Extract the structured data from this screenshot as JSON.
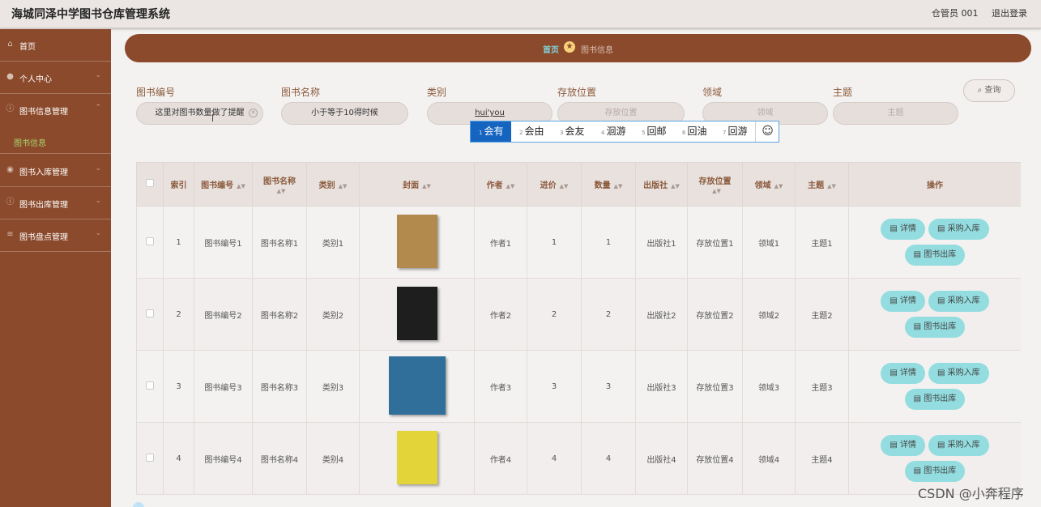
{
  "header": {
    "title": "海城同泽中学图书仓库管理系统",
    "user": "仓管员 001",
    "logout": "退出登录"
  },
  "sidebar": {
    "items": [
      {
        "label": "首页",
        "icon": "home-icon"
      },
      {
        "label": "个人中心",
        "icon": "user-icon"
      },
      {
        "label": "图书信息管理",
        "icon": "info-icon"
      },
      {
        "label": "图书入库管理",
        "icon": "location-icon"
      },
      {
        "label": "图书出库管理",
        "icon": "info-icon"
      },
      {
        "label": "图书盘点管理",
        "icon": "list-icon"
      }
    ],
    "active_sub": "图书信息"
  },
  "breadcrumb": {
    "home": "首页",
    "current": "图书信息"
  },
  "search": {
    "fields": [
      {
        "label": "图书编号",
        "value": "这里对图书数量做了提醒",
        "placeholder": ""
      },
      {
        "label": "图书名称",
        "value": "小于等于10得时候",
        "placeholder": ""
      },
      {
        "label": "类别",
        "value": "hui'you",
        "placeholder": ""
      },
      {
        "label": "存放位置",
        "value": "",
        "placeholder": "存放位置"
      },
      {
        "label": "领域",
        "value": "",
        "placeholder": "领域"
      },
      {
        "label": "主题",
        "value": "",
        "placeholder": "主题"
      }
    ],
    "query_label": "查询"
  },
  "ime": {
    "candidates": [
      {
        "num": "1",
        "text": "会有"
      },
      {
        "num": "2",
        "text": "会由"
      },
      {
        "num": "3",
        "text": "会友"
      },
      {
        "num": "4",
        "text": "洄游"
      },
      {
        "num": "5",
        "text": "回邮"
      },
      {
        "num": "6",
        "text": "回油"
      },
      {
        "num": "7",
        "text": "回游"
      }
    ],
    "emoji": "☺"
  },
  "table": {
    "headers": [
      "索引",
      "图书编号",
      "图书名称",
      "类别",
      "封面",
      "作者",
      "进价",
      "数量",
      "出版社",
      "存放位置",
      "领域",
      "主题",
      "操作"
    ],
    "rows": [
      {
        "index": "1",
        "code": "图书编号1",
        "name": "图书名称1",
        "category": "类别1",
        "cover_color": "#b28a4e",
        "author": "作者1",
        "price": "1",
        "qty": "1",
        "publisher": "出版社1",
        "location": "存放位置1",
        "field": "领域1",
        "topic": "主题1"
      },
      {
        "index": "2",
        "code": "图书编号2",
        "name": "图书名称2",
        "category": "类别2",
        "cover_color": "#1e1e1e",
        "author": "作者2",
        "price": "2",
        "qty": "2",
        "publisher": "出版社2",
        "location": "存放位置2",
        "field": "领域2",
        "topic": "主题2"
      },
      {
        "index": "3",
        "code": "图书编号3",
        "name": "图书名称3",
        "category": "类别3",
        "cover_color": "#2f6f9a",
        "author": "作者3",
        "price": "3",
        "qty": "3",
        "publisher": "出版社3",
        "location": "存放位置3",
        "field": "领域3",
        "topic": "主题3"
      },
      {
        "index": "4",
        "code": "图书编号4",
        "name": "图书名称4",
        "category": "类别4",
        "cover_color": "#e3d43a",
        "author": "作者4",
        "price": "4",
        "qty": "4",
        "publisher": "出版社4",
        "location": "存放位置4",
        "field": "领域4",
        "topic": "主题4"
      }
    ],
    "actions": {
      "detail": "详情",
      "purchase": "采购入库",
      "out": "图书出库"
    }
  },
  "watermark": "CSDN @小奔程序"
}
